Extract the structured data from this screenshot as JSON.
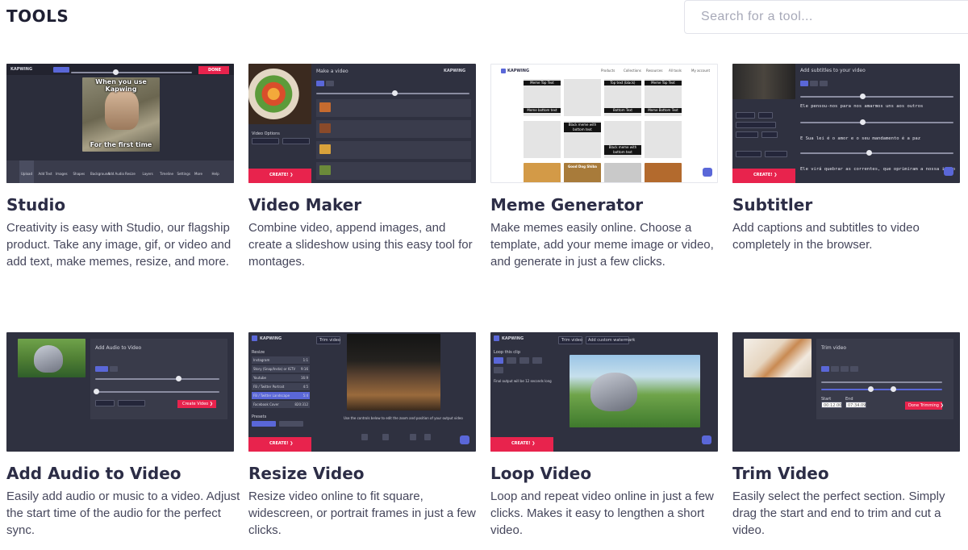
{
  "header": {
    "title": "TOOLS",
    "search_placeholder": "Search for a tool..."
  },
  "tools": [
    {
      "title": "Studio",
      "description": "Creativity is easy with Studio, our flagship product. Take any image, gif, or video and add text, make memes, resize, and more.",
      "thumb": {
        "meme_top": "When you use Kapwing",
        "meme_bottom": "For the first time",
        "done_label": "DONE",
        "brand": "KAPWING",
        "toolbar": [
          "Upload",
          "Add Text",
          "Images",
          "Shapes",
          "Background",
          "Add Audio",
          "Resize",
          "Layers",
          "Timeline",
          "Settings",
          "More",
          "Help"
        ]
      }
    },
    {
      "title": "Video Maker",
      "description": "Combine video, append images, and create a slideshow using this easy tool for montages.",
      "thumb": {
        "heading": "Make a video",
        "brand": "KAPWING",
        "options_label": "Video Options",
        "create_label": "CREATE! ❯"
      }
    },
    {
      "title": "Meme Generator",
      "description": "Make memes easily online. Choose a template, add your meme image or video, and generate in just a few clicks.",
      "thumb": {
        "brand": "KAPWING",
        "nav": [
          "Products",
          "Collections",
          "Resources",
          "All tools",
          "My account"
        ],
        "captions": [
          "Meme Top Text",
          "Top text (black)",
          "Meme Top Text",
          "Meme bottom text",
          "Bottom Text",
          "Meme Bottom Text",
          "Black meme with bottom text",
          "Black meme with bottom text",
          "Good Dog Shiba"
        ]
      }
    },
    {
      "title": "Subtitler",
      "description": "Add captions and subtitles to video completely in the browser.",
      "thumb": {
        "heading": "Add subtitles to your video",
        "create_label": "CREATE! ❯",
        "lines": [
          "Ele pensou-nos para nos amarmos uns aos outros",
          "E Sua lei é o amor e o seu mandamento é a paz",
          "Ele virá quebrar as correntes, que oprimiram a nossa irmão"
        ]
      }
    },
    {
      "title": "Add Audio to Video",
      "description": "Easily add audio or music to a video. Adjust the start time of the audio for the perfect sync.",
      "thumb": {
        "heading": "Add Audio to Video",
        "create_label": "Create Video ❯"
      }
    },
    {
      "title": "Resize Video",
      "description": "Resize video online to fit square, widescreen, or portrait frames in just a few clicks.",
      "thumb": {
        "brand": "KAPWING",
        "trim_label": "Trim video",
        "resize_label": "Resize",
        "sizes": [
          {
            "name": "Instagram",
            "ratio": "1:1"
          },
          {
            "name": "Story (Snap/Insta) or IGTV",
            "ratio": "9:16"
          },
          {
            "name": "Youtube",
            "ratio": "16:9"
          },
          {
            "name": "FB / Twitter Portrait",
            "ratio": "4:5"
          },
          {
            "name": "FB / Twitter Landscape",
            "ratio": "5:4"
          },
          {
            "name": "Facebook Cover",
            "ratio": "820:312"
          }
        ],
        "presets_label": "Presets",
        "create_label": "CREATE! ❯",
        "instructions": "Use the controls below to edit the zoom and position of your output video"
      }
    },
    {
      "title": "Loop Video",
      "description": "Loop and repeat video online in just a few clicks. Makes it easy to lengthen a short video.",
      "thumb": {
        "brand": "KAPWING",
        "trim_label": "Trim video",
        "watermark_label": "Add custom watermark",
        "loop_label": "Loop this clip",
        "counts": [
          "2x",
          "3x",
          "4x",
          "5x",
          "10x"
        ],
        "output_note": "Final output will be 12 seconds long",
        "create_label": "CREATE! ❯"
      }
    },
    {
      "title": "Trim Video",
      "description": "Easily select the perfect section. Simply drag the start and end to trim and cut a video.",
      "thumb": {
        "heading": "Trim video",
        "start_label": "Start",
        "end_label": "End",
        "start_time": "00:12.00",
        "end_time": "07:34.09",
        "done_label": "Done Trimming ❯"
      }
    }
  ],
  "colors": {
    "accent_red": "#e8234d",
    "accent_blue": "#5a67d8",
    "dark_panel": "#2f3140",
    "title_text": "#2c2d46"
  }
}
